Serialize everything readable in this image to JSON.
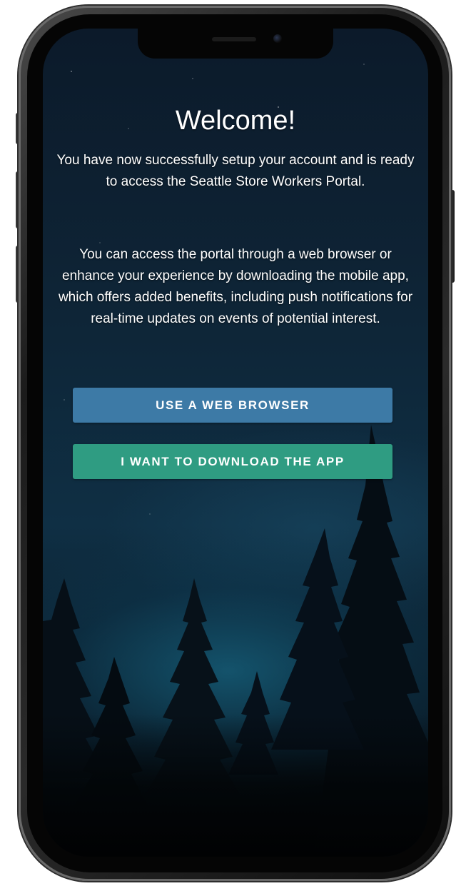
{
  "welcome": {
    "title": "Welcome!",
    "paragraph_1": "You have now successfully setup your account and is ready to access the Seattle Store Workers Portal.",
    "paragraph_2": "You can access the portal through a web browser or enhance your experience by downloading the mobile app, which offers added benefits, including push notifications for real-time updates on events of potential interest."
  },
  "actions": {
    "web_browser_label": "USE A WEB BROWSER",
    "download_app_label": "I WANT TO DOWNLOAD THE APP"
  },
  "colors": {
    "web_button": "#3d7aa6",
    "app_button": "#2f9c82",
    "text": "#ffffff"
  }
}
